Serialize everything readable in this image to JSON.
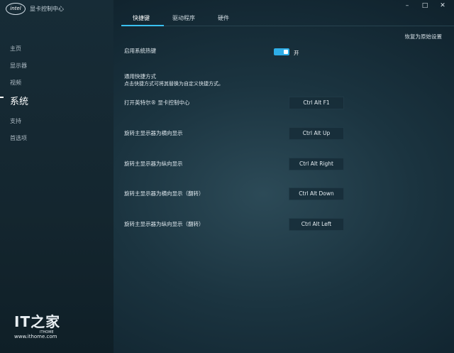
{
  "app": {
    "logo_text": "intel",
    "title": "显卡控制中心"
  },
  "window_controls": {
    "minimize": "–",
    "maximize": "□",
    "close": "✕"
  },
  "sidebar": {
    "items": [
      {
        "label": "主页"
      },
      {
        "label": "显示器"
      },
      {
        "label": "视频"
      },
      {
        "label": "系统"
      },
      {
        "label": "支持"
      },
      {
        "label": "首选项"
      }
    ],
    "active_index": 3
  },
  "tabs": [
    {
      "label": "快捷键"
    },
    {
      "label": "驱动程序"
    },
    {
      "label": "硬件"
    }
  ],
  "active_tab": 0,
  "restore_defaults": "恢复为原始设置",
  "hotkeys_toggle": {
    "label": "启用系统热键",
    "state_text": "开",
    "on": true
  },
  "common": {
    "heading": "通用快捷方式",
    "hint": "点击快捷方式可将其替换为自定义快捷方式。"
  },
  "shortcuts": [
    {
      "label": "打开英特尔® 显卡控制中心",
      "keys": "Ctrl Alt F1"
    },
    {
      "label": "旋转主显示器为横向显示",
      "keys": "Ctrl Alt Up"
    },
    {
      "label": "旋转主显示器为纵向显示",
      "keys": "Ctrl Alt Right"
    },
    {
      "label": "旋转主显示器为横向显示（翻转）",
      "keys": "Ctrl Alt Down"
    },
    {
      "label": "旋转主显示器为纵向显示（翻转）",
      "keys": "Ctrl Alt Left"
    }
  ],
  "watermark": {
    "logo": "IT之家",
    "sub": "ITHOME",
    "url": "www.ithome.com"
  },
  "colors": {
    "accent": "#3ac0f0",
    "toggle_on": "#2eaee8",
    "sidebar_bg": "#172c37"
  }
}
